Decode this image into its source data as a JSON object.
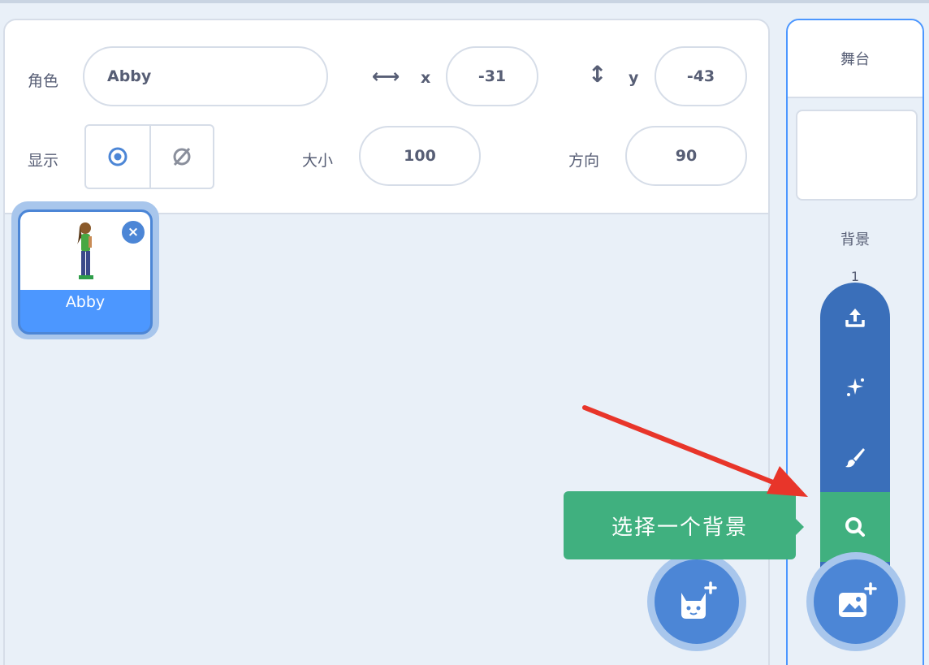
{
  "sprite_info": {
    "sprite_label": "角色",
    "sprite_name": "Abby",
    "x_label": "x",
    "x_value": "-31",
    "y_label": "y",
    "y_value": "-43",
    "show_label": "显示",
    "size_label": "大小",
    "size_value": "100",
    "direction_label": "方向",
    "direction_value": "90"
  },
  "sprites": [
    {
      "name": "Abby",
      "selected": true
    }
  ],
  "stage": {
    "header": "舞台",
    "backdrops_label": "背景",
    "backdrop_count": "1"
  },
  "backdrop_menu": {
    "items": [
      {
        "icon": "upload-icon"
      },
      {
        "icon": "surprise-icon"
      },
      {
        "icon": "paint-icon"
      },
      {
        "icon": "search-icon",
        "active": true
      }
    ],
    "tooltip": "选择一个背景"
  },
  "buttons": {
    "choose_sprite_icon": "cat-add-icon",
    "choose_backdrop_icon": "image-add-icon"
  },
  "colors": {
    "primary_blue": "#4c86d6",
    "menu_blue": "#3a6fba",
    "active_green": "#40b07f",
    "pane_bg": "#e9f0f8",
    "text": "#575e75",
    "annotation_arrow": "#e8352a"
  }
}
